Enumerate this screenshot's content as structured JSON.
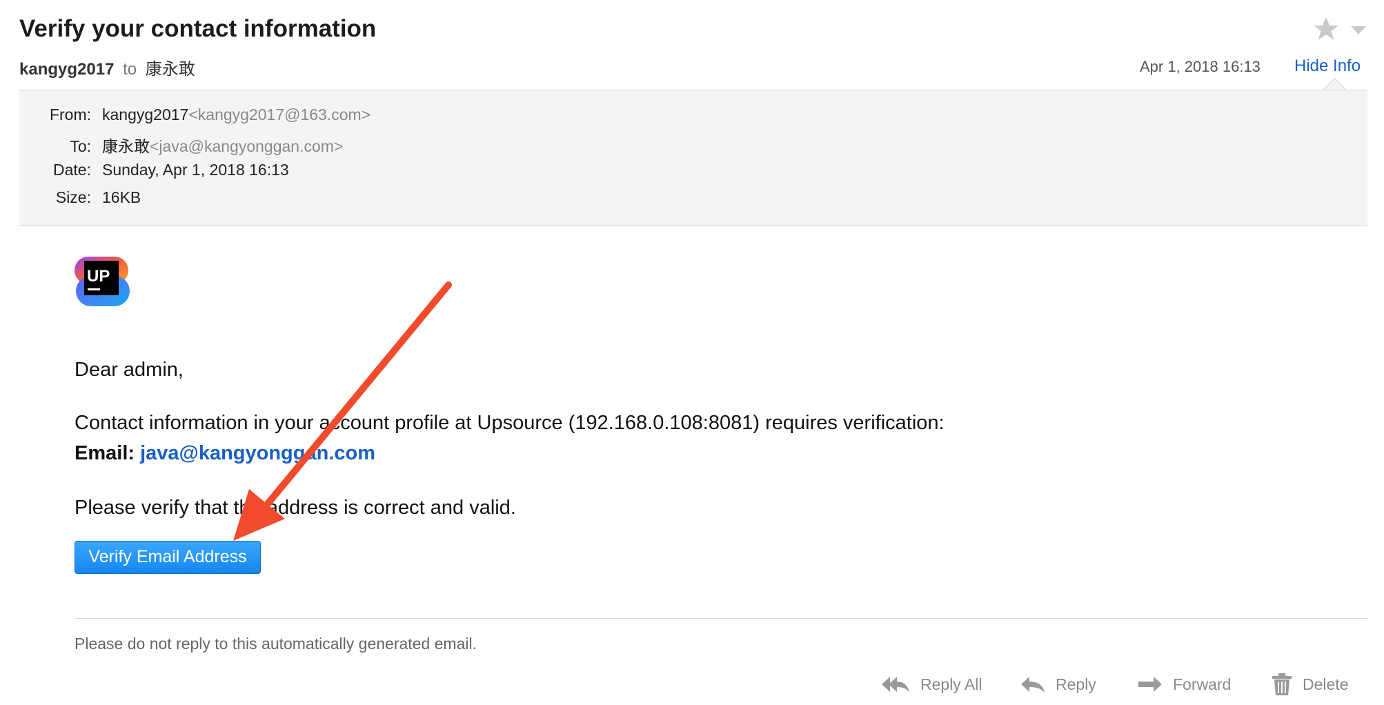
{
  "email": {
    "subject": "Verify your contact information",
    "sender_name": "kangyg2017",
    "to_word": "to",
    "recipient_name": "康永敢",
    "date_short": "Apr 1, 2018  16:13",
    "hide_info_label": "Hide Info"
  },
  "details": {
    "from_label": "From:",
    "from_name": "kangyg2017",
    "from_address": "<kangyg2017@163.com>",
    "to_label": "To:",
    "to_name": "康永敢",
    "to_address": "<java@kangyonggan.com>",
    "date_label": "Date:",
    "date_value": "Sunday, Apr 1, 2018  16:13",
    "size_label": "Size:",
    "size_value": "16KB"
  },
  "message": {
    "logo_text": "UP",
    "greeting": "Dear admin,",
    "line1": "Contact information in your account profile at Upsource (192.168.0.108:8081) requires verification:",
    "email_label": "Email:",
    "email_value": "java@kangyonggan.com",
    "line2": "Please verify that the address is correct and valid.",
    "verify_button": "Verify Email Address",
    "footer_note": "Please do not reply to this automatically generated email."
  },
  "actions": {
    "reply_all": "Reply All",
    "reply": "Reply",
    "forward": "Forward",
    "delete": "Delete"
  },
  "colors": {
    "link": "#1a5fc6",
    "button": "#1687f0",
    "annotation_arrow": "#f24a2c"
  },
  "icons": [
    "star-icon",
    "chevron-down-icon",
    "upsource-logo",
    "reply-all-icon",
    "reply-icon",
    "forward-icon",
    "trash-icon",
    "annotation-arrow"
  ]
}
